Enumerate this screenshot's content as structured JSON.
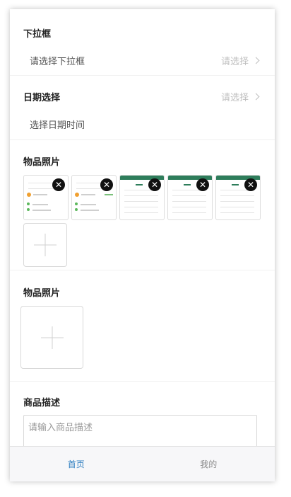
{
  "form": {
    "dropdown": {
      "title": "下拉框",
      "value_placeholder": "请选择下拉框",
      "right_placeholder": "请选择"
    },
    "date": {
      "title": "日期选择",
      "right_placeholder": "请选择",
      "value_text": "选择日期时间"
    },
    "photos1": {
      "title": "物品照片"
    },
    "photos2": {
      "title": "物品照片"
    },
    "description": {
      "title": "商品描述",
      "placeholder": "请输入商品描述"
    }
  },
  "tabbar": {
    "home": "首页",
    "mine": "我的"
  },
  "colors": {
    "active_tab": "#2b7cc0",
    "inactive_tab": "#8a8a8a",
    "placeholder": "#bfbfbf"
  }
}
